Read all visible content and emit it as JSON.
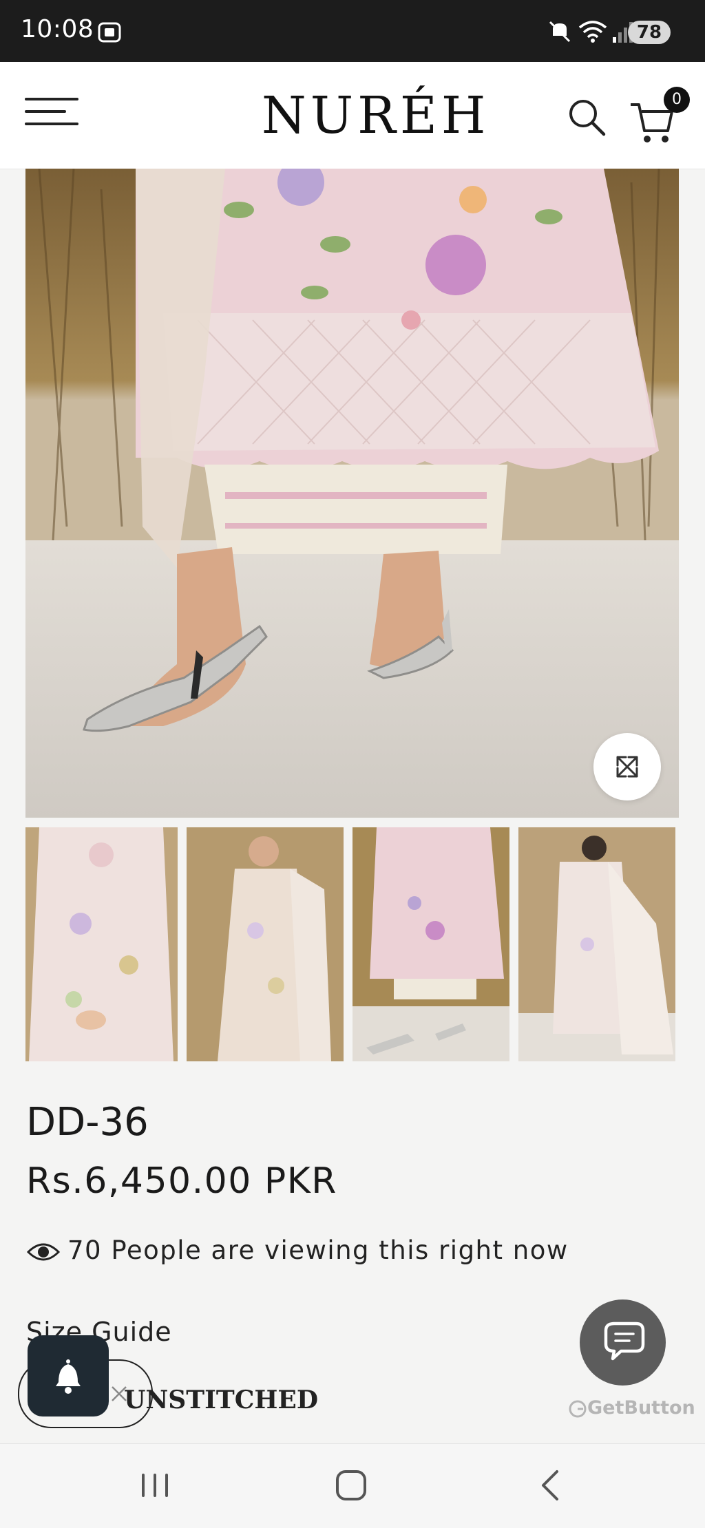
{
  "status_bar": {
    "time": "10:08",
    "battery": "78",
    "icons": [
      "screenshot-icon",
      "mute-icon",
      "wifi-icon",
      "signal-icon",
      "battery-icon"
    ]
  },
  "header": {
    "logo": "NURÉH",
    "cart_count": "0",
    "icons": [
      "menu-icon",
      "search-icon",
      "cart-icon"
    ]
  },
  "gallery": {
    "main_image": "model feet in silver sandals, pastel floral embroidered suit",
    "thumbnails": [
      "front view close-up",
      "full front view",
      "lower hem detail",
      "back view"
    ]
  },
  "product": {
    "title": "DD-36",
    "price": "Rs.6,450.00 PKR",
    "viewers": "70 People are viewing this right now",
    "size_guide": "Size Guide",
    "variant": "UNSTITCHED"
  },
  "chat": {
    "brand": "GetButton"
  },
  "colors": {
    "status_bar": "#1c1c1c",
    "header_bg": "#ffffff",
    "page_bg": "#f4f4f3",
    "chat_btn": "#5c5c5c",
    "bell_btn": "#1f2a33"
  }
}
